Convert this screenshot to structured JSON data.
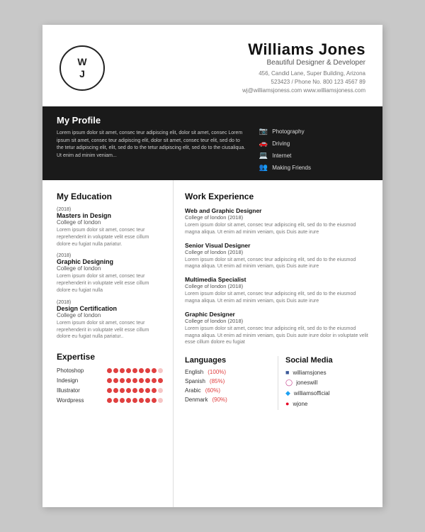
{
  "header": {
    "initials_top": "W",
    "initials_bottom": "J",
    "name": "Williams Jones",
    "title": "Beautiful Designer & Developer",
    "address": "456, Candid Lane, Super Building, Arizona",
    "postal": "523423  /  Phone No. 800 123 4567 89",
    "website": "wj@williamsjoness.com  www.williamsjoness.com"
  },
  "profile": {
    "section_label": "My Profile",
    "text": "Lorem ipsum dolor sit amet, consec teur adipiscing elit, dolor sit amet, consec Lorem ipsum  sit amet, consec teur adipiscing elit, dolor sit amet, consec teur elit, sed do to the tetur adipiscing elit, elit, sed do to the tetur adipiscing elit, sed do to the ciusaliqua. Ut enim ad minim veniam...",
    "interests": [
      {
        "icon": "📷",
        "label": "Photography"
      },
      {
        "icon": "🚗",
        "label": "Driving"
      },
      {
        "icon": "💻",
        "label": "Internet"
      },
      {
        "icon": "👥",
        "label": "Making Friends"
      }
    ]
  },
  "education": {
    "section_label": "My Education",
    "entries": [
      {
        "year": "(2018)",
        "degree": "Masters in Design",
        "school": "College of london",
        "desc": "Lorem ipsum dolor sit amet, consec teur reprehenderit in voluptate velit esse cillum dolore eu fugiat nulla pariatur."
      },
      {
        "year": "(2018)",
        "degree": "Graphic Designing",
        "school": "College of london",
        "desc": "Lorem ipsum dolor sit amet, consec teur reprehenderit in voluptate velit esse cillum dolore eu fugiat nulla"
      },
      {
        "year": "(2018)",
        "degree": "Design Certification",
        "school": "College of london",
        "desc": "Lorem ipsum dolor sit amet, consec teur reprehenderit in voluptate velit esse cillum dolore eu fugiat nulla pariatur.."
      }
    ]
  },
  "expertise": {
    "section_label": "Expertise",
    "items": [
      {
        "name": "Photoshop",
        "filled": 8,
        "total": 9
      },
      {
        "name": "Indesign",
        "filled": 9,
        "total": 9
      },
      {
        "name": "Illustrator",
        "filled": 8,
        "total": 9
      },
      {
        "name": "Wordpress",
        "filled": 8,
        "total": 9
      }
    ]
  },
  "work": {
    "section_label": "Work Experience",
    "entries": [
      {
        "role": "Web and Graphic Designer",
        "company": "College of london (2018)",
        "desc": "Lorem ipsum dolor sit amet, consec teur adipiscing elit, sed do to the eiusmod magna aliqua. Ut enim ad minim veniam, quis Duis aute irure"
      },
      {
        "role": "Senior Visual Designer",
        "company": "College of london (2018)",
        "desc": "Lorem ipsum dolor sit amet, consec teur adipiscing elit, sed do to the eiusmod magna aliqua. Ut enim ad minim veniam, quis Duis aute irure"
      },
      {
        "role": "Multimedia Specialist",
        "company": "College of london (2018)",
        "desc": "Lorem ipsum dolor sit amet, consec teur adipiscing elit, sed do to the eiusmod magna aliqua. Ut enim ad minim veniam, quis Duis aute irure"
      },
      {
        "role": "Graphic Designer",
        "company": "College of london (2018)",
        "desc": "Lorem ipsum dolor sit amet, consec teur adipiscing elit, sed do to the eiusmod magna aliqua. Ut enim ad minim veniam, quis Duis aute irure dolor in voluptate velit esse cillum dolore eu fugiat"
      }
    ]
  },
  "languages": {
    "section_label": "Languages",
    "entries": [
      {
        "name": "English",
        "pct": "(100%)"
      },
      {
        "name": "Spanish",
        "pct": "(85%)"
      },
      {
        "name": "Arabic",
        "pct": "(60%)"
      },
      {
        "name": "Denmark",
        "pct": "(90%)"
      }
    ]
  },
  "social": {
    "section_label": "Social Media",
    "entries": [
      {
        "icon": "fb",
        "handle": "williamsjones"
      },
      {
        "icon": "ig",
        "handle": "joneswill"
      },
      {
        "icon": "tw",
        "handle": "williamsofficial"
      },
      {
        "icon": "pt",
        "handle": "wjone"
      }
    ]
  }
}
